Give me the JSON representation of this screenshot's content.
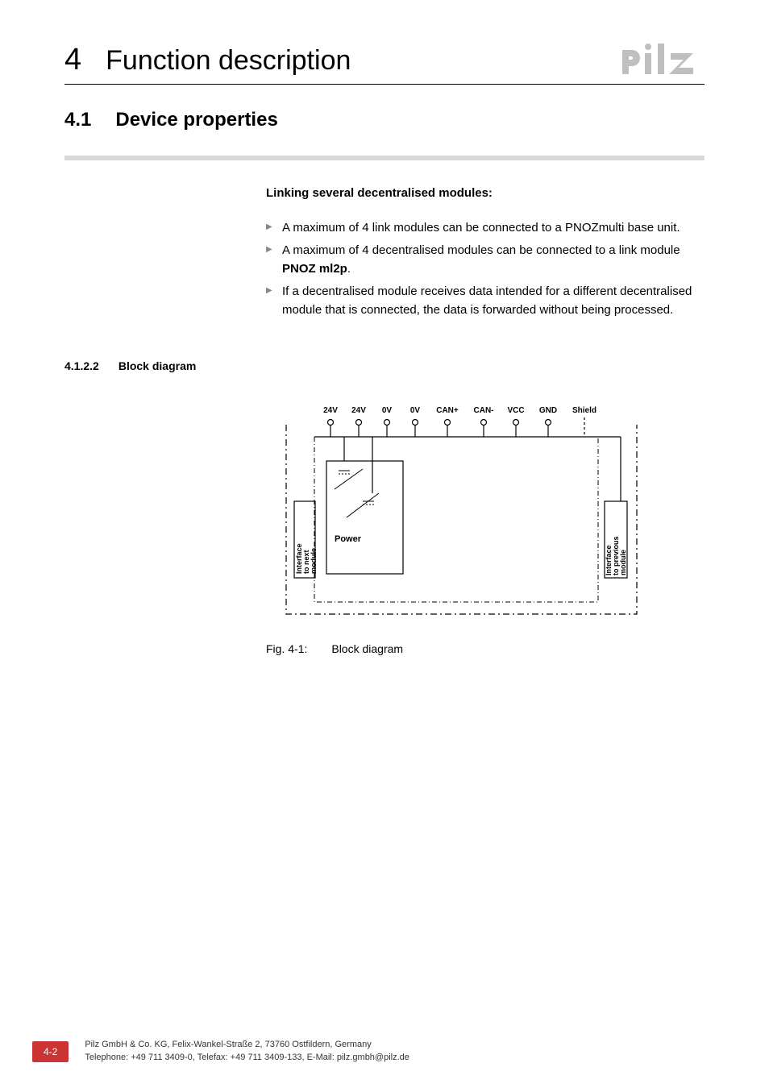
{
  "chapter": {
    "num": "4",
    "title": "Function description"
  },
  "section": {
    "num": "4.1",
    "title": "Device properties"
  },
  "content": {
    "heading": "Linking several decentralised modules:",
    "bullets": [
      {
        "pre": "A maximum of 4 link modules can be connected to a PNOZmulti base unit.",
        "bold": "",
        "post": ""
      },
      {
        "pre": "A maximum of 4 decentralised modules can be connected to a link module ",
        "bold": "PNOZ ml2p",
        "post": "."
      },
      {
        "pre": "If a decentralised module receives data intended for a different decentralised module that is connected, the data is forwarded without being processed.",
        "bold": "",
        "post": ""
      }
    ]
  },
  "subsection": {
    "num": "4.1.2.2",
    "title": "Block diagram"
  },
  "diagram": {
    "terminals": [
      "24V",
      "24V",
      "0V",
      "0V",
      "CAN+",
      "CAN-",
      "VCC",
      "GND",
      "Shield"
    ],
    "left_label": "Interface\nto next\nmodule",
    "right_label": "Interface\nto previous\nmodule",
    "power_label": "Power"
  },
  "figure": {
    "num": "Fig. 4-1:",
    "caption": "Block diagram"
  },
  "footer": {
    "page": "4-2",
    "line1": "Pilz GmbH & Co. KG, Felix-Wankel-Straße 2, 73760 Ostfildern, Germany",
    "line2": "Telephone: +49 711 3409-0, Telefax: +49 711 3409-133, E-Mail: pilz.gmbh@pilz.de"
  }
}
